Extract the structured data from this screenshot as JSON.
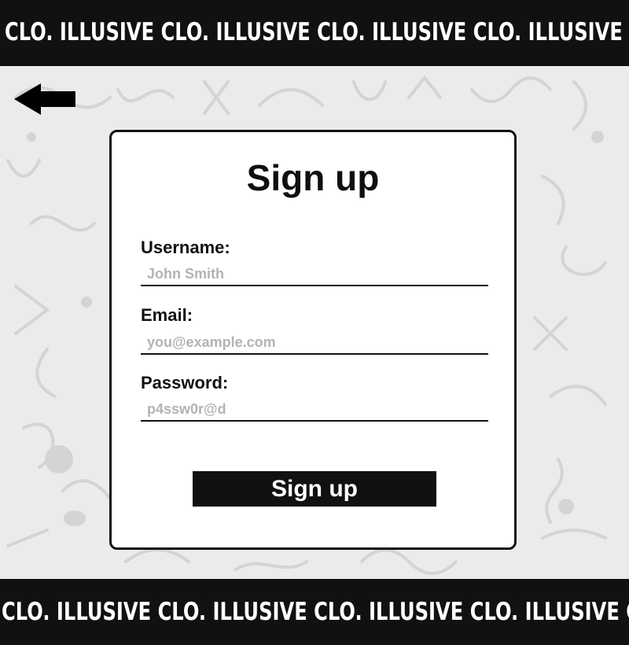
{
  "header_marquee": {
    "text": "CLO. ILLUSIVE CLO. ILLUSIVE CLO. ILLUSIVE CLO. ILLUSIVE CLO. ILLUSIVE CLO. I"
  },
  "footer_marquee": {
    "text": "CLO. ILLUSIVE CLO. ILLUSIVE CLO. ILLUSIVE CLO. ILLUSIVE CLO."
  },
  "back_button": {
    "icon": "arrow-left-icon"
  },
  "form": {
    "title": "Sign up",
    "fields": [
      {
        "label": "Username:",
        "placeholder": "John Smith",
        "value": ""
      },
      {
        "label": "Email:",
        "placeholder": "you@example.com",
        "value": ""
      },
      {
        "label": "Password:",
        "placeholder": "p4ssw0r@d",
        "value": ""
      }
    ],
    "submit_label": "Sign up"
  },
  "colors": {
    "bar_background": "#111111",
    "page_background": "#ebebeb",
    "card_background": "#ffffff",
    "placeholder_text": "#b3b3b3",
    "doodle": "#d4d4d4"
  }
}
